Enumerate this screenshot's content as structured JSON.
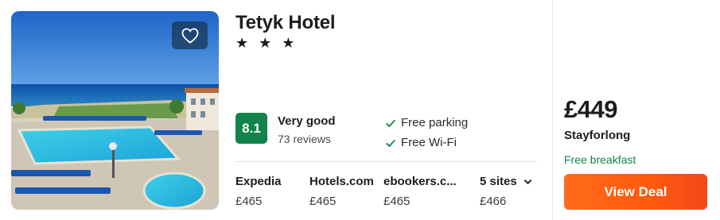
{
  "hotel": {
    "name": "Tetyk Hotel",
    "stars_text": "★ ★ ★",
    "star_rating": 3
  },
  "rating": {
    "score": "8.1",
    "label": "Very good",
    "reviews": "73 reviews"
  },
  "amenities": [
    "Free parking",
    "Free Wi-Fi"
  ],
  "providers": [
    {
      "name": "Expedia",
      "price": "£465"
    },
    {
      "name": "Hotels.com",
      "price": "£465"
    },
    {
      "name": "ebookers.c...",
      "price": "£465"
    },
    {
      "name": "5 sites",
      "price": "£466"
    }
  ],
  "deal": {
    "price": "£449",
    "site": "Stayforlong",
    "extra": "Free breakfast",
    "button_label": "View Deal"
  },
  "colors": {
    "score_badge": "#12834a",
    "free_breakfast": "#12834a",
    "view_deal": "#ff5a0f"
  },
  "icons": {
    "favorite": "heart-icon",
    "amenity_check": "check-icon",
    "sites_dropdown": "chevron-down-icon"
  }
}
